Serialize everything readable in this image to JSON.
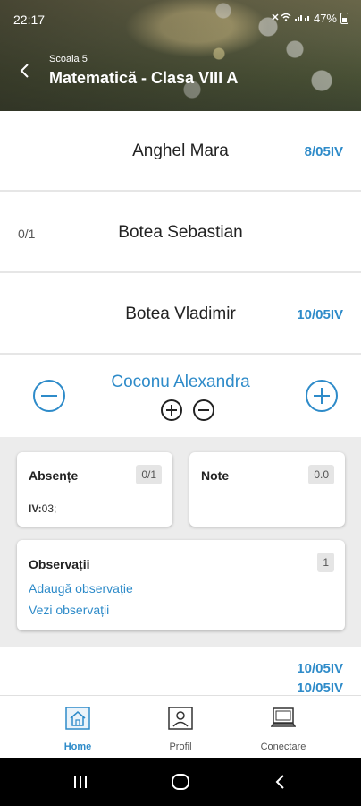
{
  "status_bar": {
    "time": "22:17",
    "battery": "47%"
  },
  "header": {
    "school": "Scoala 5",
    "title": "Matematică - Clasa VIII A"
  },
  "students": [
    {
      "name": "Anghel Mara",
      "grade": "8/05IV",
      "absences": ""
    },
    {
      "name": "Botea Sebastian",
      "grade": "",
      "absences": "0/1"
    },
    {
      "name": "Botea Vladimir",
      "grade": "10/05IV",
      "absences": ""
    }
  ],
  "selected_student": {
    "name": "Coconu Alexandra",
    "absente": {
      "title": "Absențe",
      "badge": "0/1",
      "detail_label": "IV:",
      "detail_value": "03;"
    },
    "note": {
      "title": "Note",
      "badge": "0.0"
    },
    "observatii": {
      "title": "Observații",
      "badge": "1",
      "add_link": "Adaugă observație",
      "view_link": "Vezi observații"
    }
  },
  "partial_row": {
    "grades": [
      "10/05IV",
      "10/05IV"
    ]
  },
  "bottom_nav": [
    {
      "label": "Home",
      "icon": "home-icon",
      "active": true
    },
    {
      "label": "Profil",
      "icon": "profile-icon",
      "active": false
    },
    {
      "label": "Conectare",
      "icon": "computer-icon",
      "active": false
    }
  ],
  "colors": {
    "accent": "#2e8bc9",
    "panel_bg": "#ececec",
    "badge_bg": "#e5e5e5"
  }
}
